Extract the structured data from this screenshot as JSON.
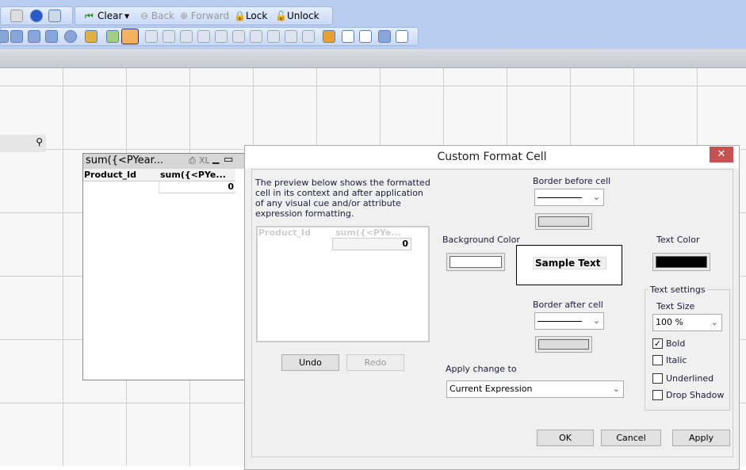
{
  "toolbar": {
    "clear": "Clear",
    "back": "Back",
    "forward": "Forward",
    "lock": "Lock",
    "unlock": "Unlock"
  },
  "search_icon": "magnifier-icon",
  "sheet_object": {
    "title": "sum({<PYear...",
    "xl": "XL",
    "columns": [
      "Product_Id",
      "sum({<PYe..."
    ],
    "value": "0"
  },
  "dialog": {
    "title": "Custom Format Cell",
    "close": "✕",
    "description": "The preview below shows the formatted cell in its context and after application of any visual cue and/or attribute expression formatting.",
    "preview": {
      "columns": [
        "Product_Id",
        "sum({<PYe..."
      ],
      "value": "0"
    },
    "undo": "Undo",
    "redo": "Redo",
    "border_before": "Border before cell",
    "border_after": "Border after cell",
    "background_color": "Background Color",
    "text_color": "Text Color",
    "sample_text": "Sample Text",
    "text_settings": "Text settings",
    "text_size": "Text Size",
    "text_size_value": "100 %",
    "bold": "Bold",
    "italic": "Italic",
    "underlined": "Underlined",
    "drop_shadow": "Drop Shadow",
    "checks": {
      "bold": true,
      "italic": false,
      "underlined": false,
      "drop_shadow": false
    },
    "apply_change_to": "Apply change to",
    "apply_target": "Current Expression",
    "ok": "OK",
    "cancel": "Cancel",
    "apply": "Apply"
  },
  "colors": {
    "text_color": "#000000",
    "close": "#c75050"
  }
}
